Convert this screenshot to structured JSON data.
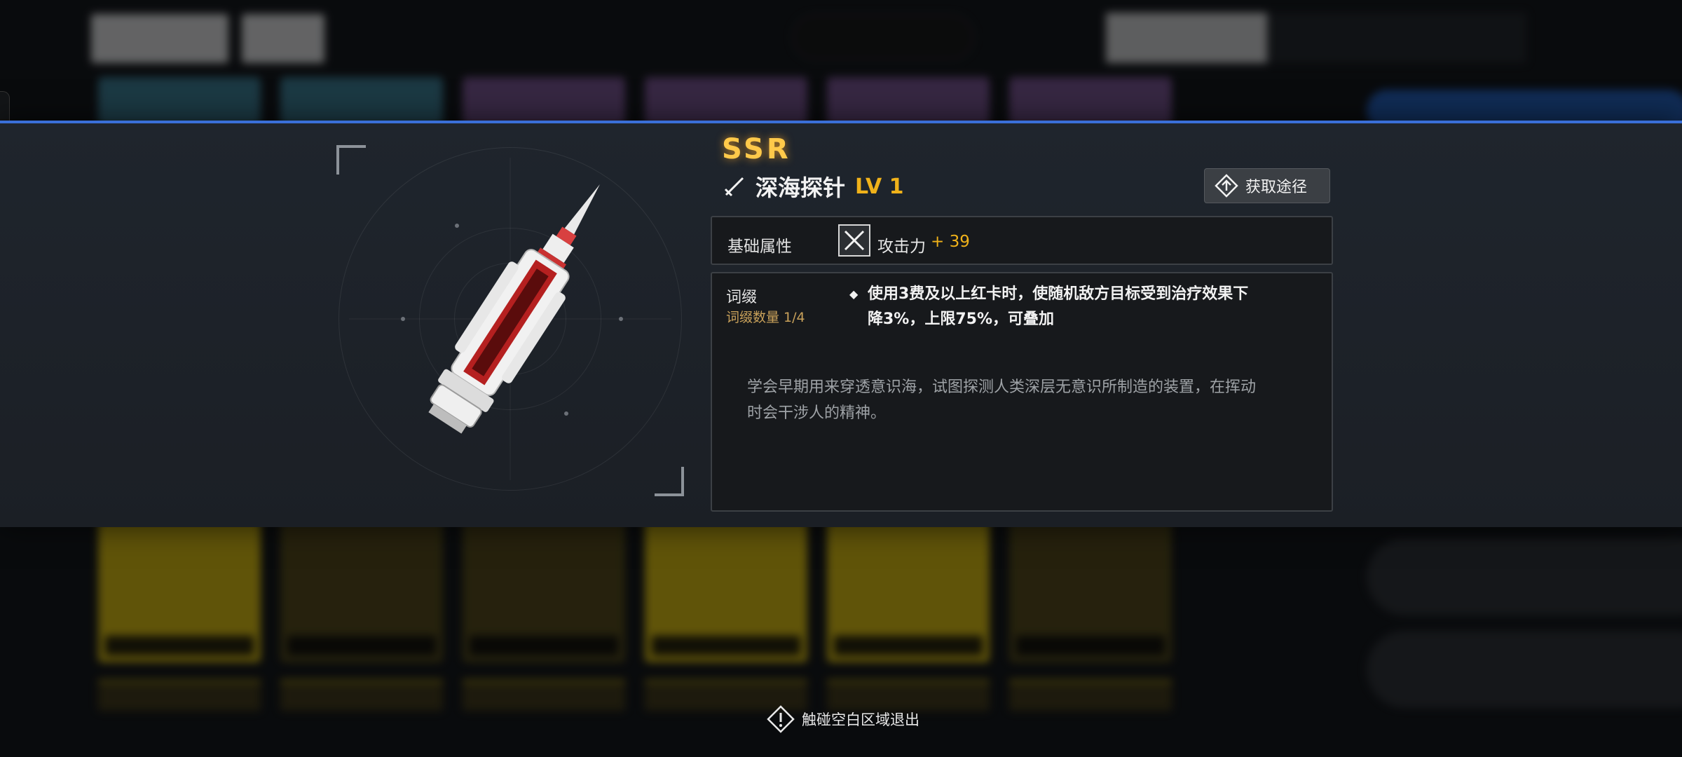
{
  "item": {
    "rarity": "SSR",
    "name": "深海探针",
    "level": "LV 1"
  },
  "source_button": {
    "label": "获取途径"
  },
  "base_attributes": {
    "label": "基础属性",
    "attack_label": "攻击力",
    "attack_value": "+ 39"
  },
  "affix": {
    "label": "词缀",
    "count": "词缀数量 1/4",
    "bullet": "◆",
    "effect": "使用3费及以上红卡时，使随机敌方目标受到治疗效果下降3%，上限75%，可叠加",
    "lore": "学会早期用来穿透意识海，试图探测人类深层无意识所制造的装置，在挥动时会干涉人的精神。"
  },
  "exit_hint": "触碰空白区域退出",
  "colors": {
    "accent_blue": "#3a6fd8",
    "rarity_gold": "#ffc94a",
    "level_gold": "#f0b21a",
    "affix_count": "#c9a15a"
  }
}
